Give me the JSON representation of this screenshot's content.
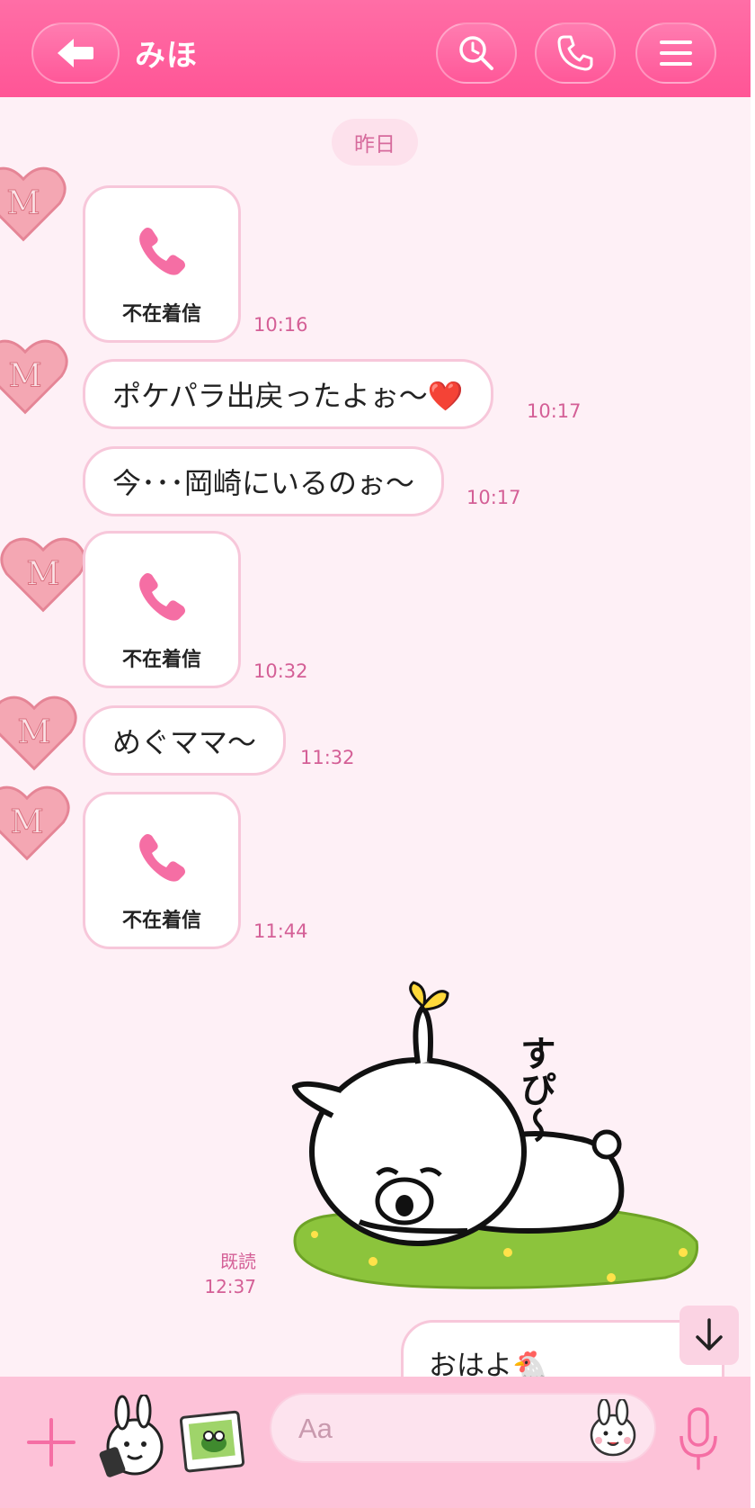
{
  "header": {
    "title": "みほ",
    "back_icon": "back-arrow-icon",
    "search_icon": "search-icon",
    "call_icon": "phone-icon",
    "menu_icon": "menu-icon"
  },
  "date_separator": "昨日",
  "messages": [
    {
      "type": "missed-call",
      "label": "不在着信",
      "time": "10:16"
    },
    {
      "type": "text",
      "text": "ポケパラ出戻ったよぉ〜❤️",
      "time": "10:17"
    },
    {
      "type": "text",
      "text": "今･･･岡崎にいるのぉ〜",
      "time": "10:17"
    },
    {
      "type": "missed-call",
      "label": "不在着信",
      "time": "10:32"
    },
    {
      "type": "text",
      "text": "めぐママ〜",
      "time": "11:32"
    },
    {
      "type": "missed-call",
      "label": "不在着信",
      "time": "11:44"
    }
  ],
  "sticker": {
    "caption": "すぴ〜",
    "read_label": "既読",
    "time": "12:37"
  },
  "outgoing": {
    "text": "おはよ🐔"
  },
  "input": {
    "placeholder": "Aa"
  },
  "colors": {
    "header": "#ff5c9b",
    "background": "#fef0f6",
    "accent": "#d45f96",
    "input_bar": "#fdc2d8"
  }
}
